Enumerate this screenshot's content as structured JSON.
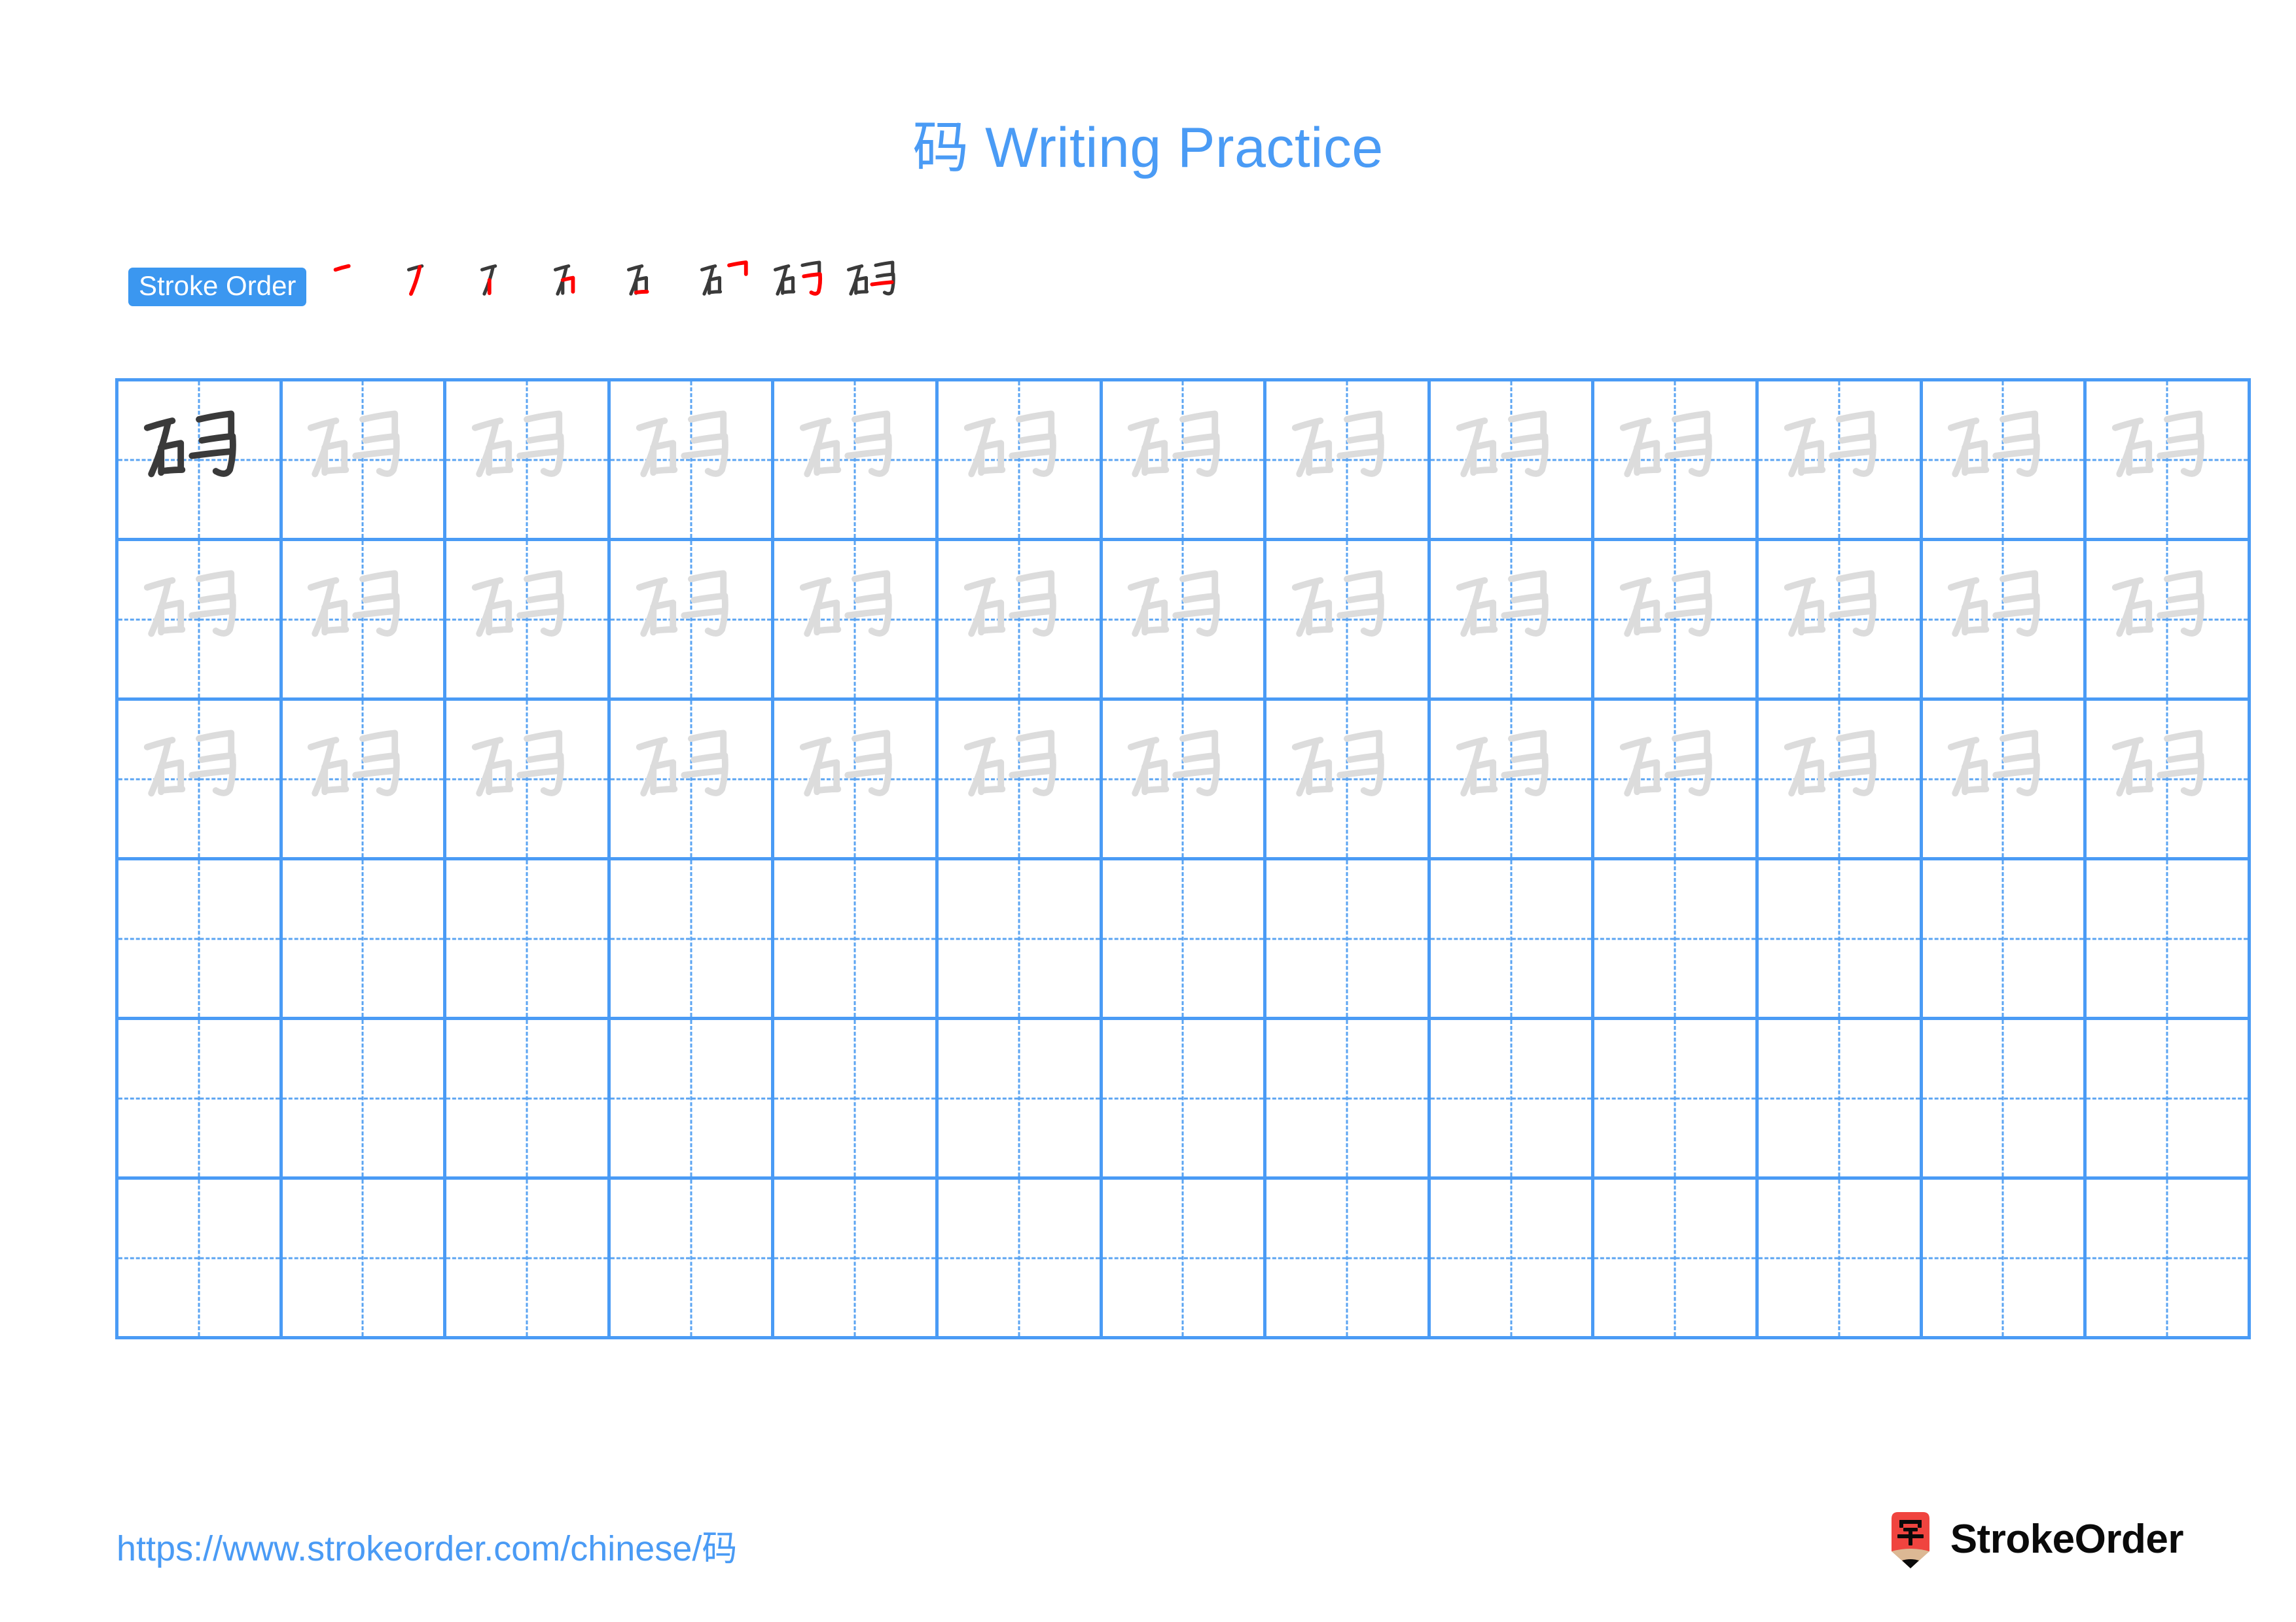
{
  "page": {
    "character": "码",
    "title": "码 Writing Practice",
    "background_color": "#ffffff"
  },
  "colors": {
    "accent_blue": "#4a9bf5",
    "badge_blue": "#3b97f0",
    "grid_line": "#4a9bf5",
    "guide_dash": "#5ba4f2",
    "example_ink": "#3a3a3a",
    "trace_ink": "#dcdcdc",
    "new_stroke_red": "#ff0000",
    "logo_red": "#f0443f",
    "logo_wood": "#dcb894",
    "logo_text": "#0a0a0a"
  },
  "stroke_order": {
    "badge_label": "Stroke Order",
    "total_strokes": 8,
    "steps": [
      {
        "index": 1,
        "name": "heng",
        "description": "horizontal"
      },
      {
        "index": 2,
        "name": "pie",
        "description": "left-falling"
      },
      {
        "index": 3,
        "name": "shu",
        "description": "vertical"
      },
      {
        "index": 4,
        "name": "heng-zhe",
        "description": "horizontal-turn"
      },
      {
        "index": 5,
        "name": "heng",
        "description": "horizontal closing"
      },
      {
        "index": 6,
        "name": "heng-zhe",
        "description": "horizontal-turn (right part)"
      },
      {
        "index": 7,
        "name": "shu-zhe-zhe-gou",
        "description": "vertical-turn-hook"
      },
      {
        "index": 8,
        "name": "heng",
        "description": "final horizontal"
      }
    ]
  },
  "grid": {
    "columns": 13,
    "rows": 6,
    "cells": [
      [
        "example",
        "trace",
        "trace",
        "trace",
        "trace",
        "trace",
        "trace",
        "trace",
        "trace",
        "trace",
        "trace",
        "trace",
        "trace"
      ],
      [
        "trace",
        "trace",
        "trace",
        "trace",
        "trace",
        "trace",
        "trace",
        "trace",
        "trace",
        "trace",
        "trace",
        "trace",
        "trace"
      ],
      [
        "trace",
        "trace",
        "trace",
        "trace",
        "trace",
        "trace",
        "trace",
        "trace",
        "trace",
        "trace",
        "trace",
        "trace",
        "trace"
      ],
      [
        "empty",
        "empty",
        "empty",
        "empty",
        "empty",
        "empty",
        "empty",
        "empty",
        "empty",
        "empty",
        "empty",
        "empty",
        "empty"
      ],
      [
        "empty",
        "empty",
        "empty",
        "empty",
        "empty",
        "empty",
        "empty",
        "empty",
        "empty",
        "empty",
        "empty",
        "empty",
        "empty"
      ],
      [
        "empty",
        "empty",
        "empty",
        "empty",
        "empty",
        "empty",
        "empty",
        "empty",
        "empty",
        "empty",
        "empty",
        "empty",
        "empty"
      ]
    ]
  },
  "footer": {
    "url": "https://www.strokeorder.com/chinese/码",
    "brand_name": "StrokeOrder",
    "logo_character": "字"
  }
}
